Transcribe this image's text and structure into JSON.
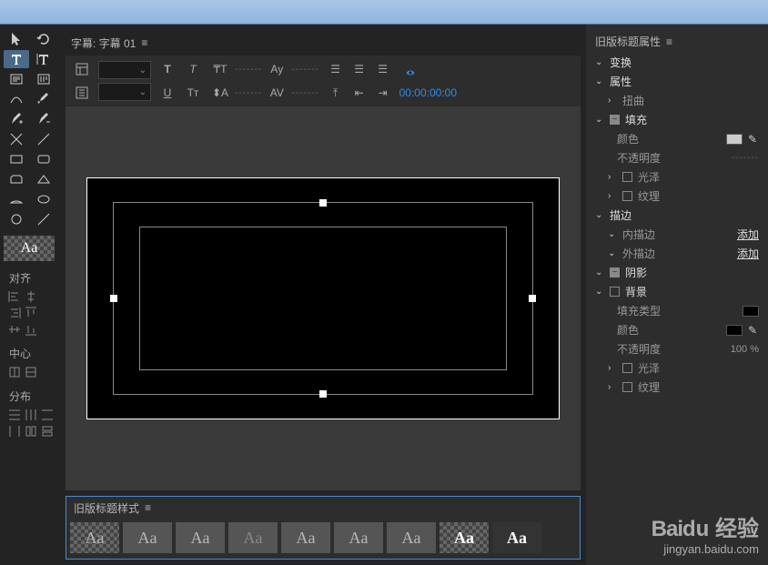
{
  "tab": {
    "title": "字幕: 字幕 01"
  },
  "timecode": "00:00:00:00",
  "propsPanel": {
    "title": "旧版标题属性",
    "transform": "变换",
    "attributes": "属性",
    "distort": "扭曲",
    "fill": "填充",
    "color": "颜色",
    "opacity": "不透明度",
    "sheen": "光泽",
    "texture": "纹理",
    "stroke": "描边",
    "innerStroke": "内描边",
    "outerStroke": "外描边",
    "add": "添加",
    "shadow": "阴影",
    "background": "背景",
    "fillType": "填充类型",
    "bgOpacityVal": "100 %"
  },
  "alignPanel": {
    "align": "对齐",
    "center": "中心",
    "distribute": "分布"
  },
  "stylesPanel": {
    "title": "旧版标题样式"
  },
  "watermark": {
    "brand": "Baidu 经验",
    "url": "jingyan.baidu.com"
  }
}
